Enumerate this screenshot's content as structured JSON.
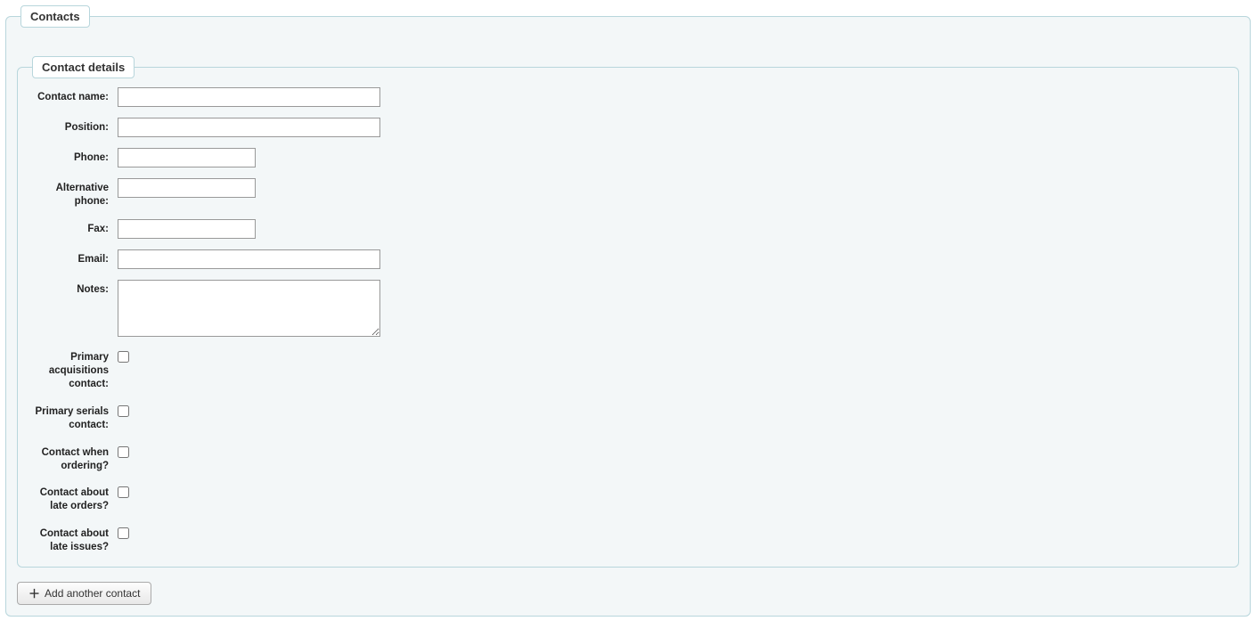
{
  "contacts": {
    "legend": "Contacts",
    "details": {
      "legend": "Contact details",
      "fields": {
        "contact_name": {
          "label": "Contact name:",
          "value": ""
        },
        "position": {
          "label": "Position:",
          "value": ""
        },
        "phone": {
          "label": "Phone:",
          "value": ""
        },
        "alt_phone": {
          "label": "Alternative phone:",
          "value": ""
        },
        "fax": {
          "label": "Fax:",
          "value": ""
        },
        "email": {
          "label": "Email:",
          "value": ""
        },
        "notes": {
          "label": "Notes:",
          "value": ""
        },
        "primary_acq": {
          "label": "Primary acquisitions contact:"
        },
        "primary_serials": {
          "label": "Primary serials contact:"
        },
        "contact_ordering": {
          "label": "Contact when ordering?"
        },
        "contact_late_orders": {
          "label": "Contact about late orders?"
        },
        "contact_late_issues": {
          "label": "Contact about late issues?"
        }
      }
    },
    "add_button": "Add another contact"
  }
}
